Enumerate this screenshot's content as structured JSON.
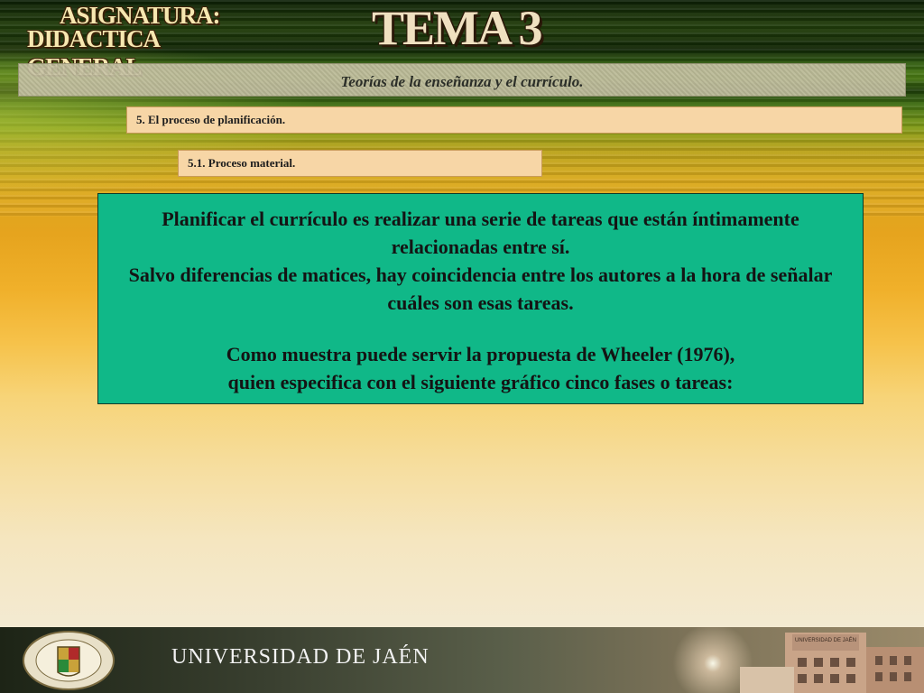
{
  "header": {
    "asignatura_line1": "ASIGNATURA:",
    "asignatura_line2": "DIDACTICA GENERAL",
    "tema": "TEMA 3"
  },
  "title_bar": {
    "text": "Teorías de la enseñanza y el currículo."
  },
  "section": {
    "text": "5. El proceso de planificación."
  },
  "subsection": {
    "text": "5.1. Proceso material."
  },
  "main_box": {
    "p1": "Planificar el currículo es realizar una serie de tareas que están íntimamente relacionadas entre sí.",
    "p2": "Salvo diferencias de matices, hay coincidencia entre los autores a la hora de señalar cuáles son esas tareas.",
    "p3": "Como muestra puede servir la propuesta de Wheeler (1976),",
    "p4": "quien especifica con el  siguiente gráfico cinco fases o tareas:"
  },
  "footer": {
    "university_name": "UNIVERSIDAD DE JAÉN",
    "building_sign": "UNIVERSIDAD DE JAÉN"
  },
  "colors": {
    "main_box_bg": "#10b888",
    "section_bar_bg": "#f7d6a6",
    "title_bar_bg": "#c9c5a8"
  }
}
